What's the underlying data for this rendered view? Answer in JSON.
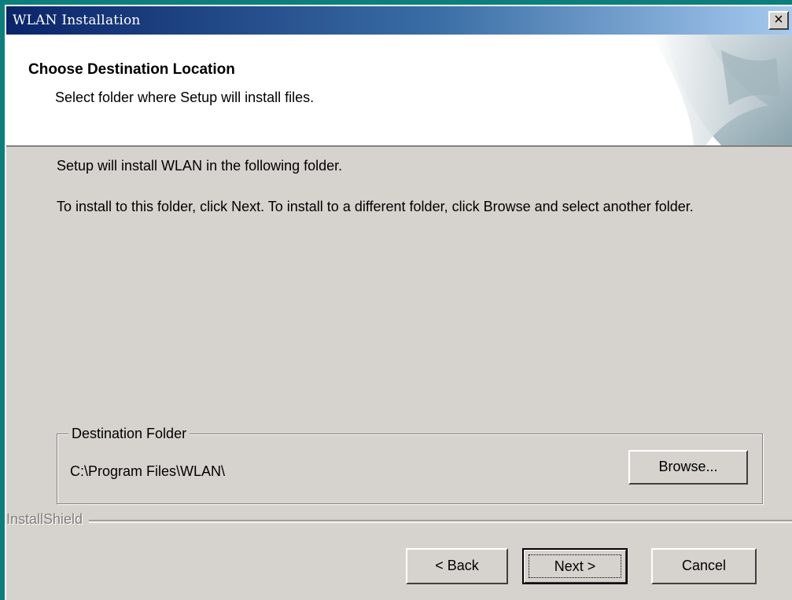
{
  "window": {
    "title": "WLAN Installation",
    "close_label": "✕"
  },
  "header": {
    "title": "Choose Destination Location",
    "subtitle": "Select folder where Setup will install files."
  },
  "body": {
    "line1": "Setup will install WLAN in the following folder.",
    "line2": "To install to this folder, click Next. To install to a different folder, click Browse and select another folder."
  },
  "destination": {
    "group_label": "Destination Folder",
    "path": "C:\\Program Files\\WLAN\\",
    "browse_label": "Browse..."
  },
  "branding": {
    "text": "InstallShield"
  },
  "buttons": {
    "back_label": "< Back",
    "next_label": "Next >",
    "cancel_label": "Cancel"
  },
  "icons": {
    "close": "close-icon",
    "header_art": "page-curl-graphic"
  }
}
